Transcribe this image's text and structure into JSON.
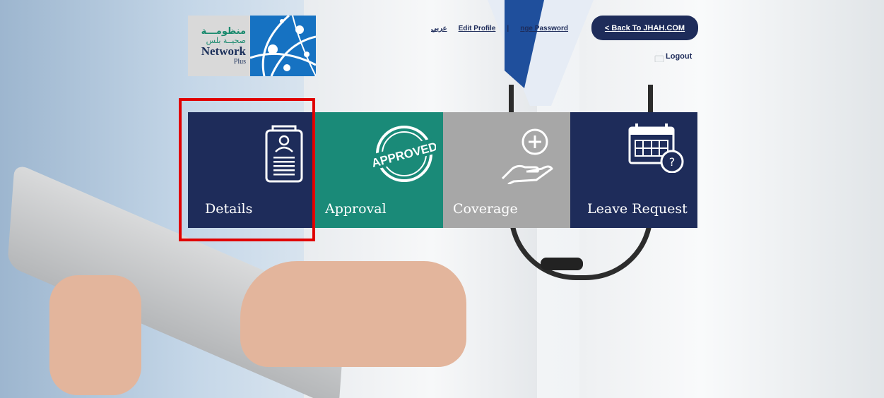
{
  "header": {
    "logo": {
      "arabic_line1": "منظومـــة",
      "arabic_line2": "صحيــة بلس",
      "brand": "Network",
      "sub": "Plus"
    },
    "links": {
      "arabic": "عربي",
      "edit_profile": "Edit Profile",
      "separator": "|",
      "change_password": "nge Password"
    },
    "back_button": "< Back To JHAH.COM",
    "logout": "Logout"
  },
  "tiles": [
    {
      "label": "Details",
      "icon": "document-person-icon"
    },
    {
      "label": "Approval",
      "icon": "approved-stamp-icon"
    },
    {
      "label": "Coverage",
      "icon": "hand-plus-icon"
    },
    {
      "label": "Leave Request",
      "icon": "calendar-question-icon"
    }
  ],
  "colors": {
    "navy": "#1e2c5a",
    "teal": "#1a8a78",
    "gray": "#a7a7a7",
    "highlight": "#e00000"
  }
}
